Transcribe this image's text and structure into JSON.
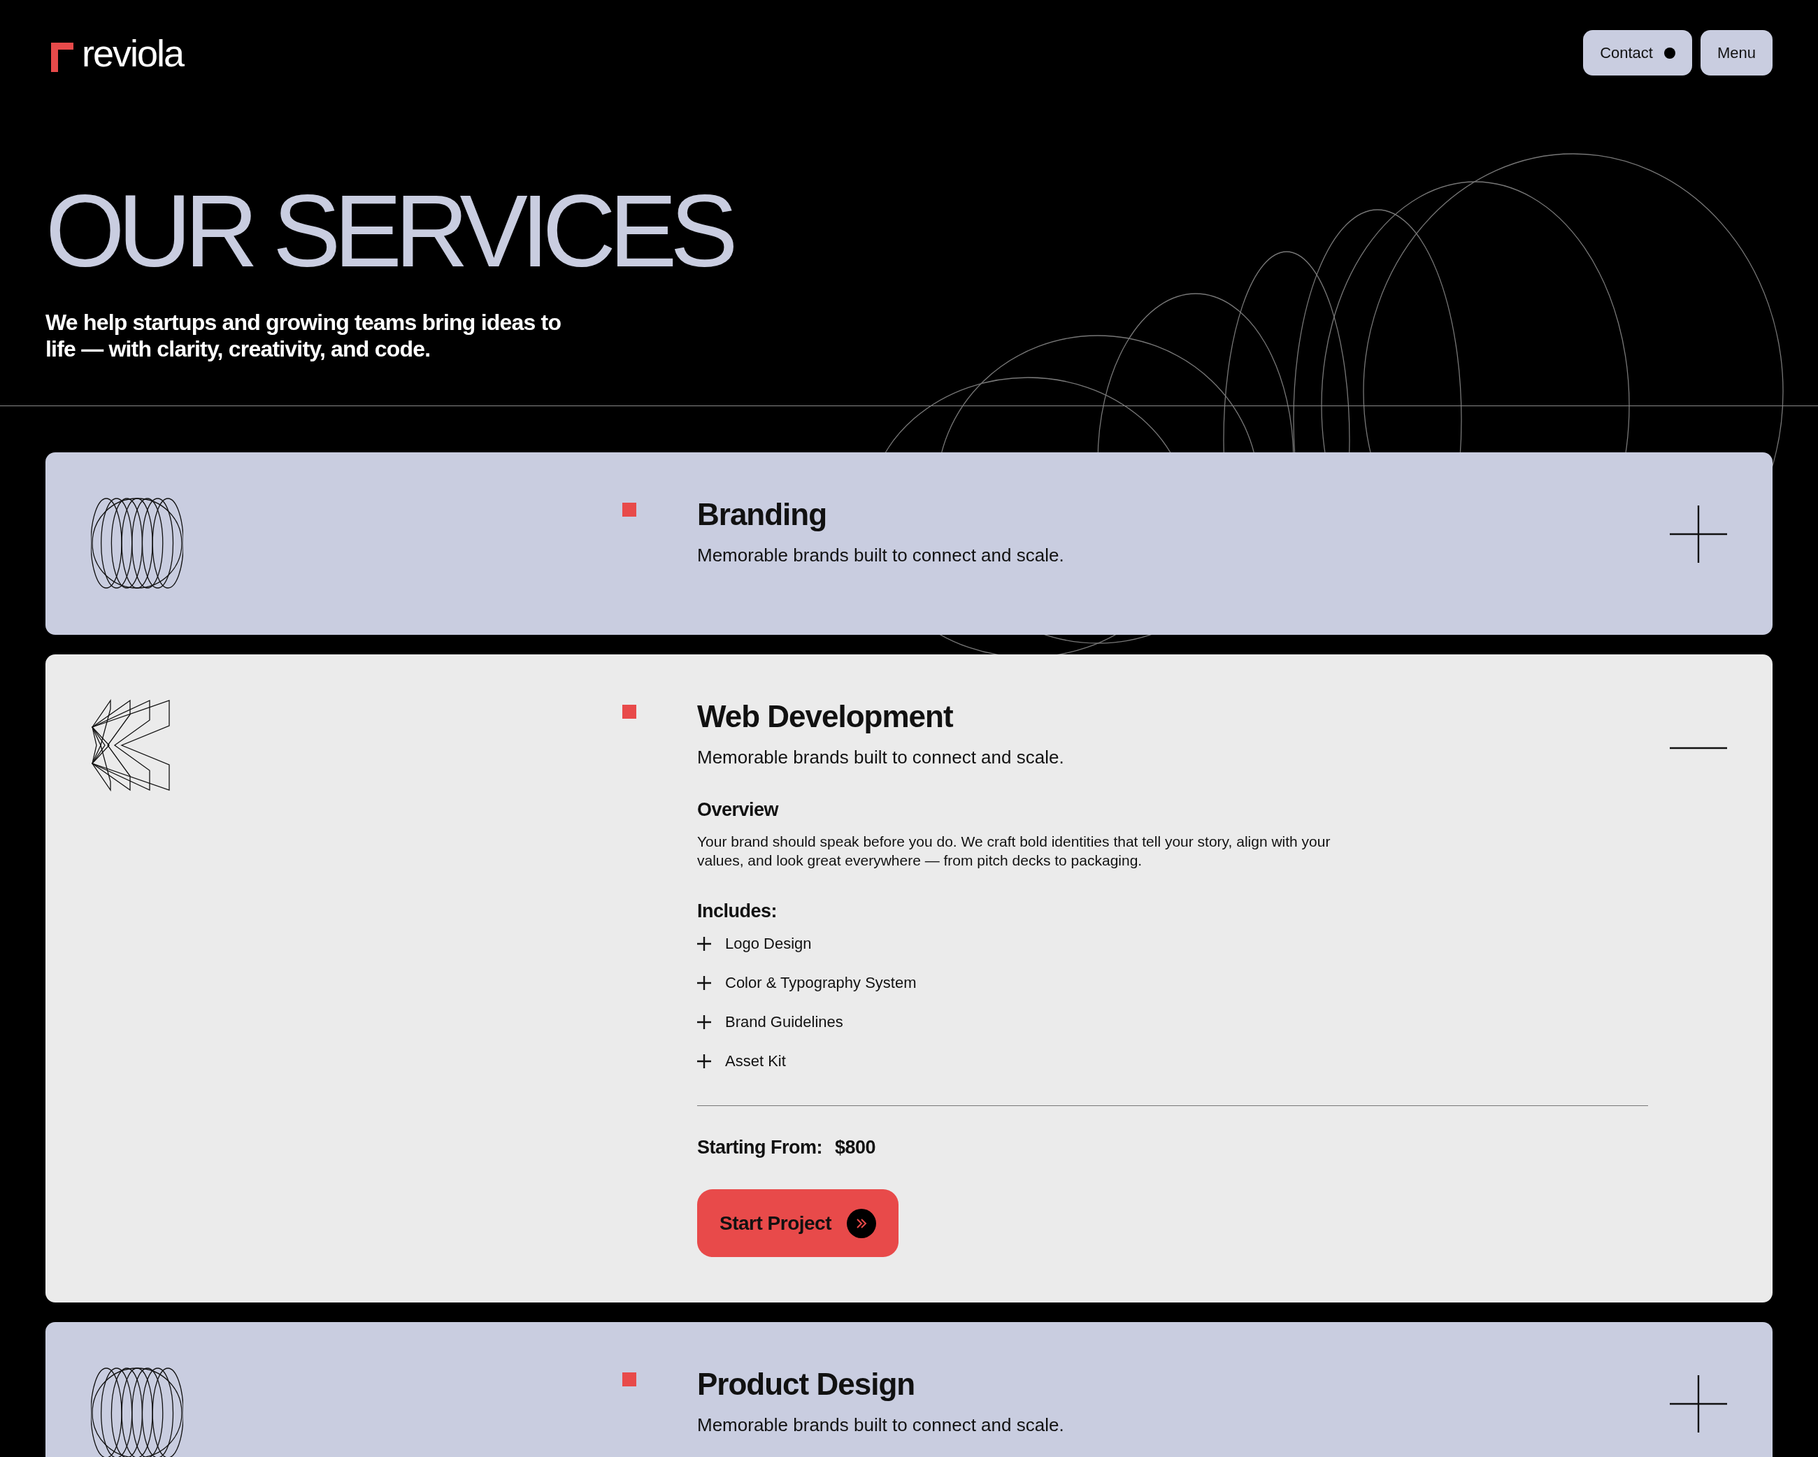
{
  "header": {
    "logo": "reviola",
    "buttons": [
      {
        "label": "Contact",
        "kind": "dot"
      },
      {
        "label": "Menu",
        "kind": "plain"
      }
    ]
  },
  "hero": {
    "title": "OUR SERVICES",
    "subtitle": "We help startups and growing teams bring ideas to life — with clarity, creativity, and code."
  },
  "services": [
    {
      "title": "Branding",
      "description": "Memorable brands built to connect and scale.",
      "kind": "rings",
      "expanded": false
    },
    {
      "title": "Web Development",
      "description": "Memorable brands built to connect and scale.",
      "kind": "chevrons",
      "expanded": true,
      "overview_heading": "Overview",
      "overview": "Your brand should speak before you do. We craft bold identities that tell your story, align with your values, and look great everywhere — from pitch decks to packaging.",
      "includes_heading": "Includes:",
      "includes": [
        "Logo Design",
        "Color & Typography System",
        "Brand Guidelines",
        "Asset Kit"
      ],
      "price_label": "Starting From:",
      "price": "$800",
      "cta": "Start Project"
    },
    {
      "title": "Product Design",
      "description": "Memorable brands built to connect and scale.",
      "kind": "rings",
      "expanded": false
    }
  ]
}
